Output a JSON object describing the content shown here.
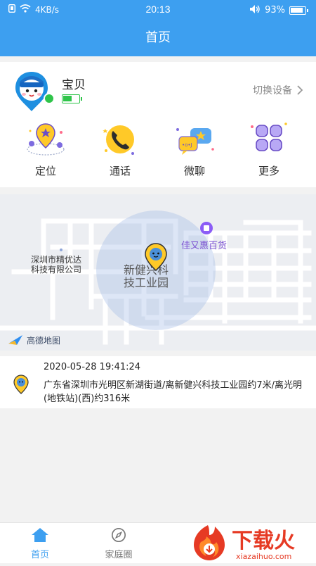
{
  "status_bar": {
    "network_speed": "4KB/s",
    "time": "20:13",
    "battery": "93%"
  },
  "header": {
    "title": "首页"
  },
  "profile": {
    "name": "宝贝",
    "switch_device": "切换设备",
    "battery_level": 0.55
  },
  "functions": [
    {
      "label": "定位",
      "icon": "location-icon"
    },
    {
      "label": "通话",
      "icon": "phone-icon"
    },
    {
      "label": "微聊",
      "icon": "chat-icon"
    },
    {
      "label": "更多",
      "icon": "more-grid-icon"
    }
  ],
  "map": {
    "poi_1": "深圳市精优达",
    "poi_1b": "科技有限公司",
    "poi_2": "新健兴科",
    "poi_2b": "技工业园",
    "poi_3": "佳又惠百货",
    "provider": "高德地图"
  },
  "location": {
    "time": "2020-05-28 19:41:24",
    "address": "广东省深圳市光明区新湖街道/离新健兴科技工业园约7米/离光明(地铁站)(西)约316米"
  },
  "tabs": [
    {
      "label": "首页",
      "active": true
    },
    {
      "label": "家庭圈",
      "active": false
    }
  ],
  "watermark": {
    "text": "下载火",
    "url": "xiazaihuo.com"
  },
  "colors": {
    "primary": "#3d9ff0",
    "online": "#2fc44a",
    "watermark": "#e63a24"
  }
}
